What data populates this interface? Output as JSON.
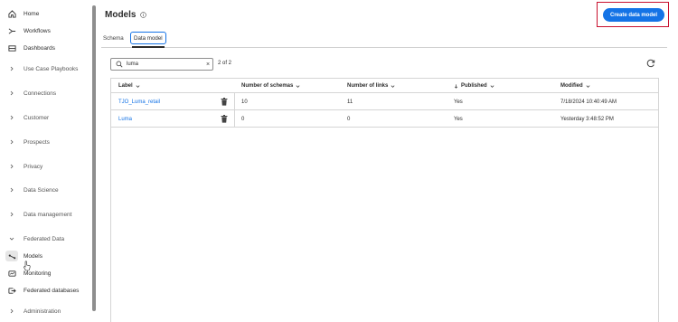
{
  "sidebar": {
    "items": [
      {
        "label": "Home",
        "icon": "home-icon"
      },
      {
        "label": "Workflows",
        "icon": "workflow-icon"
      },
      {
        "label": "Dashboards",
        "icon": "dashboard-icon"
      },
      {
        "label": "Use Case Playbooks",
        "icon": "chevron-right-icon"
      },
      {
        "label": "Connections",
        "icon": "chevron-right-icon"
      },
      {
        "label": "Customer",
        "icon": "chevron-right-icon"
      },
      {
        "label": "Prospects",
        "icon": "chevron-right-icon"
      },
      {
        "label": "Privacy",
        "icon": "chevron-right-icon"
      },
      {
        "label": "Data Science",
        "icon": "chevron-right-icon"
      },
      {
        "label": "Data management",
        "icon": "chevron-right-icon"
      },
      {
        "label": "Federated Data",
        "icon": "chevron-down-icon"
      },
      {
        "label": "Models",
        "icon": "models-icon"
      },
      {
        "label": "Monitoring",
        "icon": "monitoring-icon"
      },
      {
        "label": "Federated databases",
        "icon": "database-icon"
      },
      {
        "label": "Administration",
        "icon": "chevron-right-icon"
      }
    ]
  },
  "header": {
    "title": "Models",
    "create_label": "Create data model"
  },
  "tabs": [
    {
      "label": "Schema"
    },
    {
      "label": "Data model"
    }
  ],
  "search": {
    "value": "luma",
    "count": "2 of 2"
  },
  "table": {
    "columns": [
      {
        "label": "Label"
      },
      {
        "label": "Number of schemas"
      },
      {
        "label": "Number of links"
      },
      {
        "label": "Published"
      },
      {
        "label": "Modified"
      }
    ],
    "rows": [
      {
        "label": "TJO_Luma_retail",
        "schemas": "10",
        "links": "11",
        "published": "Yes",
        "modified": "7/18/2024 10:40:49 AM"
      },
      {
        "label": "Luma",
        "schemas": "0",
        "links": "0",
        "published": "Yes",
        "modified": "Yesterday 3:48:52 PM"
      }
    ]
  },
  "colors": {
    "accent": "#1473e6",
    "highlight_border": "#c8102e"
  }
}
